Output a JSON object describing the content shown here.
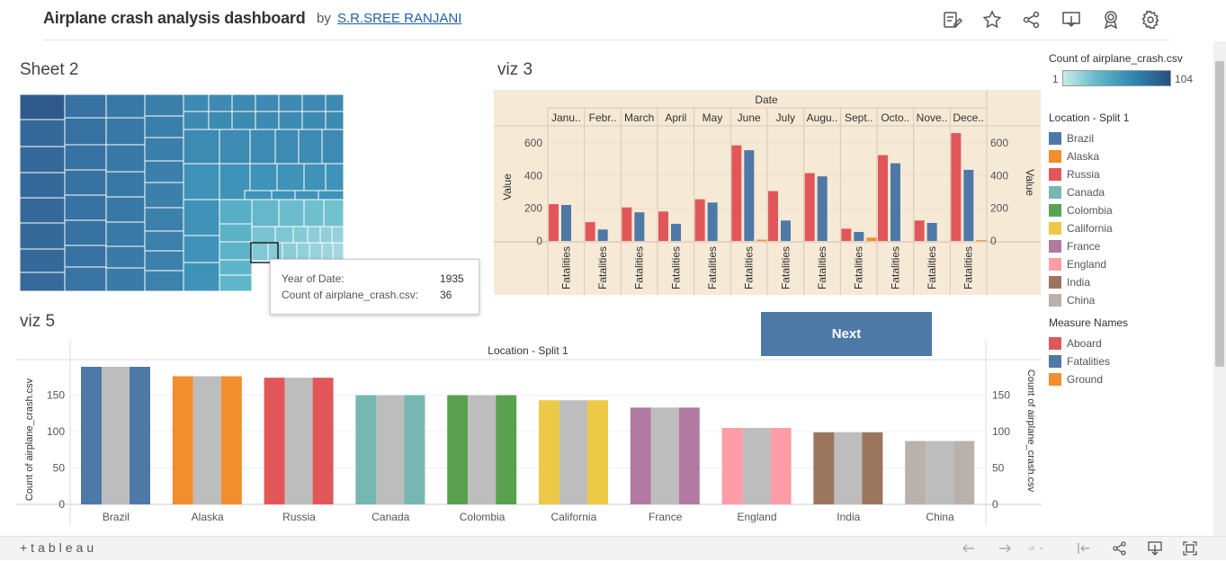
{
  "header": {
    "title": "Airplane crash analysis dashboard",
    "by": "by",
    "author": "S.R.SREE RANJANI",
    "toolbar_icons": [
      "edit-icon",
      "star-icon",
      "share-icon",
      "download-icon",
      "badge-icon",
      "gear-icon"
    ]
  },
  "sheet2": {
    "title": "Sheet 2",
    "tooltip": {
      "label1": "Year of Date:",
      "value1": "1935",
      "label2": "Count of airplane_crash.csv:",
      "value2": "36"
    }
  },
  "viz3": {
    "title": "viz 3",
    "top_header": "Date",
    "y_label_left": "Value",
    "y_label_right": "Value",
    "y_ticks": [
      "600",
      "400",
      "200",
      "0"
    ],
    "column_label": "Fatalities"
  },
  "viz5": {
    "title": "viz 5",
    "header": "Location - Split 1",
    "y_label_left": "Count of airplane_crash.csv",
    "y_label_right": "Count of airplane_crash.csv",
    "y_ticks": [
      "150",
      "100",
      "50",
      "0"
    ]
  },
  "next_button": {
    "label": "Next"
  },
  "legend": {
    "count_title": "Count of airplane_crash.csv",
    "count_min": "1",
    "count_max": "104",
    "location_title": "Location - Split 1",
    "locations": [
      {
        "name": "Brazil",
        "color": "#4e79a7"
      },
      {
        "name": "Alaska",
        "color": "#f28e2b"
      },
      {
        "name": "Russia",
        "color": "#e15759"
      },
      {
        "name": "Canada",
        "color": "#76b7b2"
      },
      {
        "name": "Colombia",
        "color": "#59a14f"
      },
      {
        "name": "California",
        "color": "#edc948"
      },
      {
        "name": "France",
        "color": "#b07aa1"
      },
      {
        "name": "England",
        "color": "#ff9da7"
      },
      {
        "name": "India",
        "color": "#9c755f"
      },
      {
        "name": "China",
        "color": "#bab0ac"
      }
    ],
    "measure_title": "Measure Names",
    "measures": [
      {
        "name": "Aboard",
        "color": "#e15759"
      },
      {
        "name": "Fatalities",
        "color": "#4e79a7"
      },
      {
        "name": "Ground",
        "color": "#f28e2b"
      }
    ]
  },
  "footer": {
    "logo": "+tableau",
    "icons": [
      "undo-icon",
      "redo-icon",
      "revert-icon",
      "reset-icon",
      "share-icon",
      "download-icon",
      "fullscreen-icon"
    ]
  },
  "chart_data": [
    {
      "type": "bar",
      "name": "viz 3",
      "categories": [
        "Janu..",
        "Febr..",
        "March",
        "April",
        "May",
        "June",
        "July",
        "Augu..",
        "Sept..",
        "Octo..",
        "Nove..",
        "Dece.."
      ],
      "series": [
        {
          "name": "Aboard",
          "values": [
            225,
            115,
            205,
            180,
            255,
            585,
            305,
            415,
            75,
            525,
            125,
            660
          ]
        },
        {
          "name": "Fatalities",
          "values": [
            220,
            70,
            175,
            105,
            235,
            555,
            125,
            395,
            55,
            475,
            110,
            435
          ]
        },
        {
          "name": "Ground",
          "values": [
            0,
            0,
            0,
            0,
            0,
            8,
            0,
            0,
            20,
            0,
            0,
            5
          ]
        }
      ],
      "ylim": [
        -10,
        660
      ],
      "y_ticks": [
        0,
        200,
        400,
        600
      ]
    },
    {
      "type": "bar",
      "name": "viz 5",
      "categories": [
        "Brazil",
        "Alaska",
        "Russia",
        "Canada",
        "Colombia",
        "California",
        "France",
        "England",
        "India",
        "China"
      ],
      "values": [
        189,
        176,
        174,
        150,
        150,
        143,
        133,
        105,
        99,
        87
      ],
      "ylim": [
        -10,
        189
      ],
      "y_ticks": [
        0,
        50,
        100,
        150
      ]
    }
  ]
}
